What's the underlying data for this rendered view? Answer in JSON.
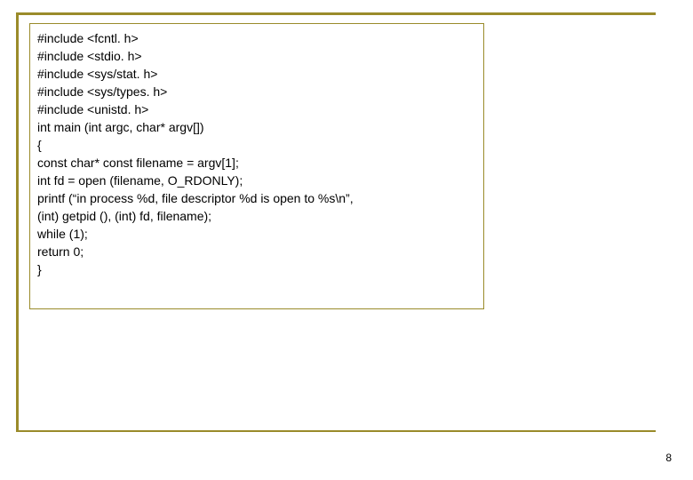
{
  "code": {
    "lines": [
      "#include <fcntl. h>",
      "#include <stdio. h>",
      "#include <sys/stat. h>",
      "#include <sys/types. h>",
      "#include <unistd. h>",
      "int main (int argc, char* argv[])",
      "{",
      "const char* const filename = argv[1];",
      "int fd = open (filename, O_RDONLY);",
      "printf (“in process %d, file descriptor %d is open to %s\\n”,",
      "(int) getpid (), (int) fd, filename);",
      "while (1);",
      "return 0;",
      "}"
    ]
  },
  "page": {
    "number": "8"
  }
}
